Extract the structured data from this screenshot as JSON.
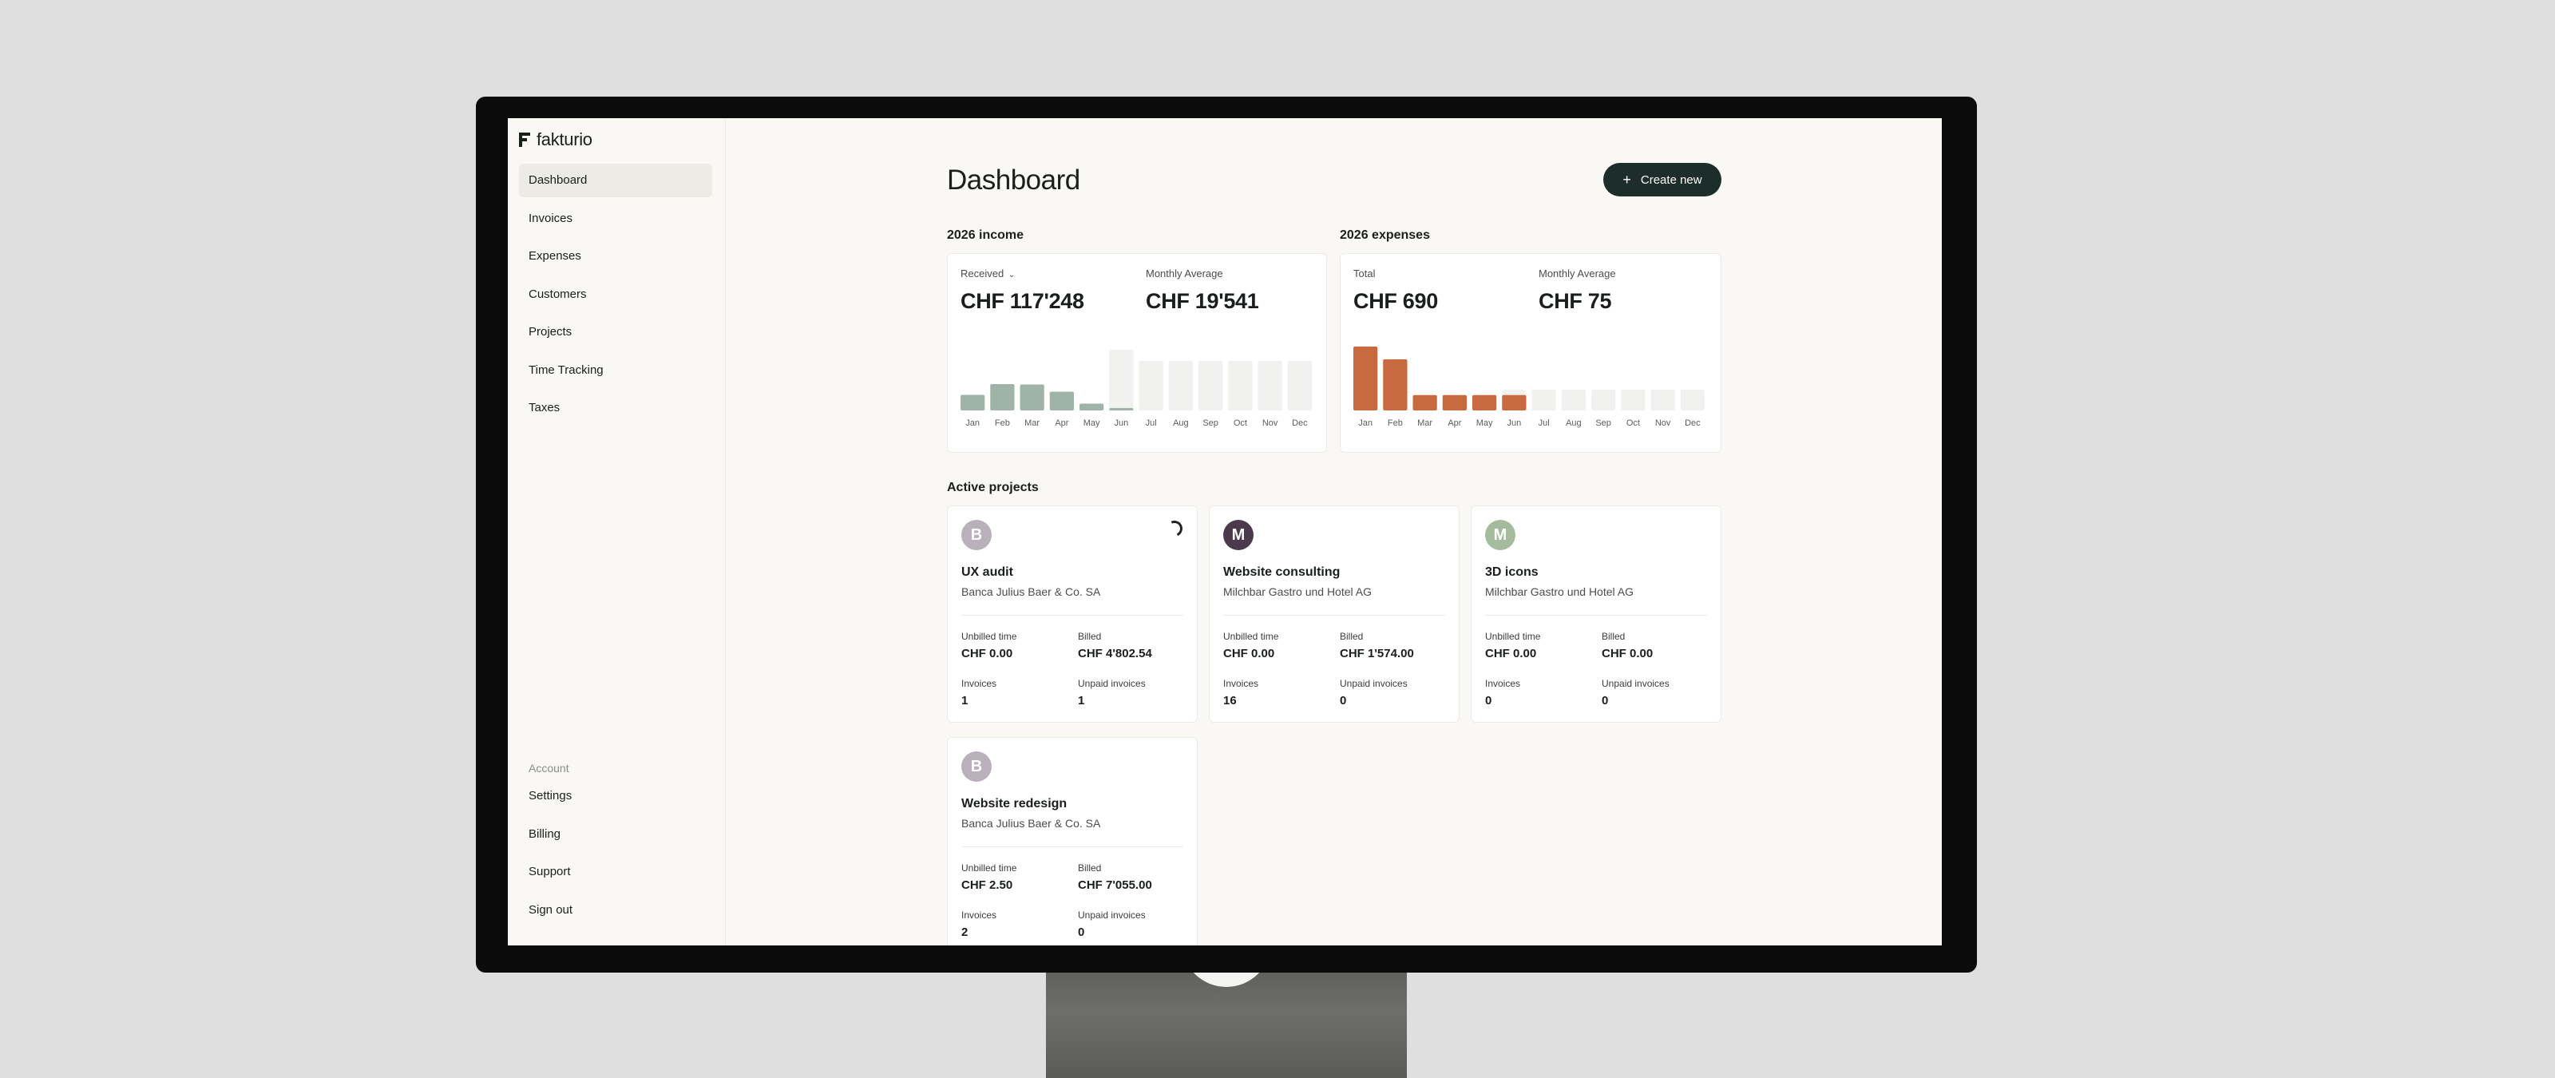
{
  "app": {
    "name": "fakturio"
  },
  "sidebar": {
    "items": [
      {
        "label": "Dashboard",
        "active": true
      },
      {
        "label": "Invoices"
      },
      {
        "label": "Expenses"
      },
      {
        "label": "Customers"
      },
      {
        "label": "Projects"
      },
      {
        "label": "Time Tracking"
      },
      {
        "label": "Taxes"
      }
    ],
    "account_label": "Account",
    "account_items": [
      {
        "label": "Settings"
      },
      {
        "label": "Billing"
      },
      {
        "label": "Support"
      },
      {
        "label": "Sign out"
      }
    ]
  },
  "header": {
    "title": "Dashboard",
    "create_label": "Create new"
  },
  "income": {
    "section_label": "2026 income",
    "primary_label": "Received",
    "primary_value": "CHF 117'248",
    "secondary_label": "Monthly Average",
    "secondary_value": "CHF 19'541"
  },
  "expenses": {
    "section_label": "2026 expenses",
    "primary_label": "Total",
    "primary_value": "CHF 690",
    "secondary_label": "Monthly Average",
    "secondary_value": "CHF 75"
  },
  "projects_section_label": "Active projects",
  "projects": [
    {
      "initial": "B",
      "avatar_color": "#b9b0bc",
      "title": "UX audit",
      "client": "Banca Julius Baer & Co. SA",
      "unbilled_label": "Unbilled time",
      "unbilled": "CHF 0.00",
      "billed_label": "Billed",
      "billed": "CHF 4'802.54",
      "invoices_label": "Invoices",
      "invoices": "1",
      "unpaid_label": "Unpaid invoices",
      "unpaid": "1",
      "loading": true
    },
    {
      "initial": "M",
      "avatar_color": "#4a3a4c",
      "title": "Website consulting",
      "client": "Milchbar Gastro und Hotel AG",
      "unbilled_label": "Unbilled time",
      "unbilled": "CHF 0.00",
      "billed_label": "Billed",
      "billed": "CHF 1'574.00",
      "invoices_label": "Invoices",
      "invoices": "16",
      "unpaid_label": "Unpaid invoices",
      "unpaid": "0"
    },
    {
      "initial": "M",
      "avatar_color": "#a4bc9c",
      "title": "3D icons",
      "client": "Milchbar Gastro und Hotel AG",
      "unbilled_label": "Unbilled time",
      "unbilled": "CHF 0.00",
      "billed_label": "Billed",
      "billed": "CHF 0.00",
      "invoices_label": "Invoices",
      "invoices": "0",
      "unpaid_label": "Unpaid invoices",
      "unpaid": "0"
    },
    {
      "initial": "B",
      "avatar_color": "#b9b0bc",
      "title": "Website redesign",
      "client": "Banca Julius Baer & Co. SA",
      "unbilled_label": "Unbilled time",
      "unbilled": "CHF 2.50",
      "billed_label": "Billed",
      "billed": "CHF 7'055.00",
      "invoices_label": "Invoices",
      "invoices": "2",
      "unpaid_label": "Unpaid invoices",
      "unpaid": "0"
    }
  ],
  "colors": {
    "income_bar": "#9fb3a9",
    "income_bar_current": "#7e9a8e",
    "expense_bar": "#c8693f",
    "future_bar": "#f1f1ef",
    "accent": "#1d2d29"
  },
  "chart_data": [
    {
      "type": "bar",
      "title": "2026 income",
      "categories": [
        "Jan",
        "Feb",
        "Mar",
        "Apr",
        "May",
        "Jun",
        "Jul",
        "Aug",
        "Sep",
        "Oct",
        "Nov",
        "Dec"
      ],
      "values": [
        19500,
        33000,
        32500,
        23500,
        8500,
        2500,
        0,
        0,
        0,
        0,
        0,
        0
      ],
      "ylim": [
        0,
        80000
      ],
      "current_month_index": 5
    },
    {
      "type": "bar",
      "title": "2026 expenses",
      "categories": [
        "Jan",
        "Feb",
        "Mar",
        "Apr",
        "May",
        "Jun",
        "Jul",
        "Aug",
        "Sep",
        "Oct",
        "Nov",
        "Dec"
      ],
      "values": [
        250,
        200,
        60,
        60,
        60,
        60,
        0,
        0,
        0,
        0,
        0,
        0
      ],
      "ylim": [
        0,
        250
      ],
      "current_month_index": 5
    }
  ]
}
